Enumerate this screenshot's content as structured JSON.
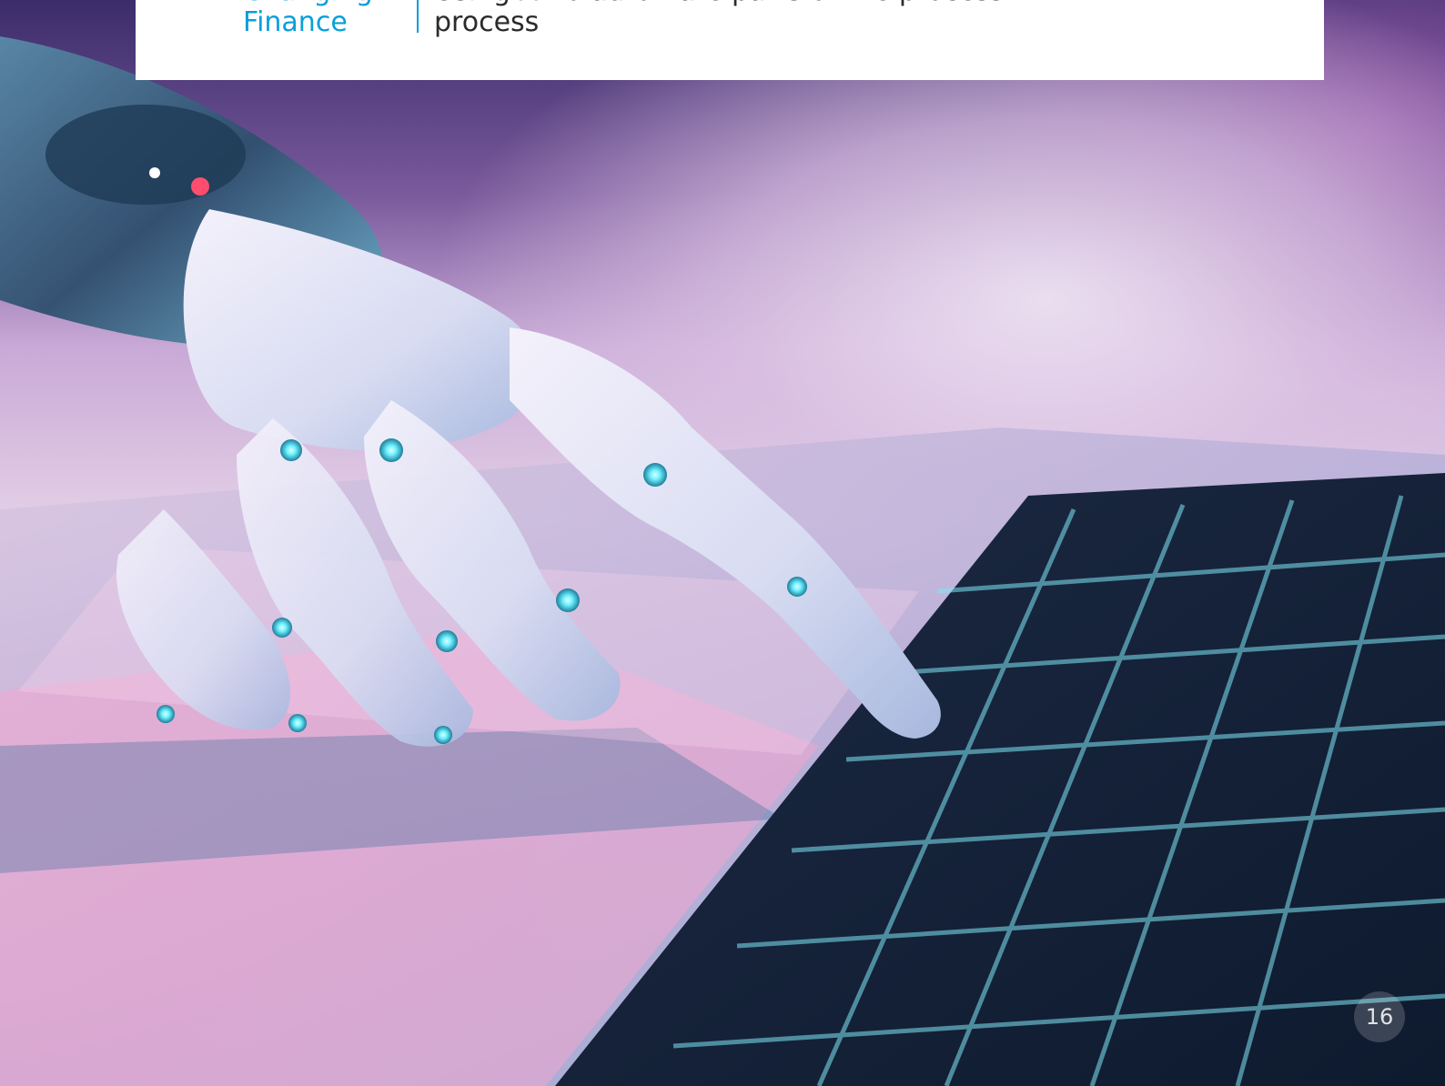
{
  "header": {
    "section_line1": "Changing",
    "section_line2": "Finance",
    "heading_line1": "Using AI to automate parts of the process",
    "heading_line2": "process"
  },
  "page": {
    "number": "16"
  },
  "photo": {
    "subject": "robot-hand-pressing-laptop-key",
    "colors": {
      "accent": "#0a9fd8",
      "glow": "#6ff2ff",
      "pink": "#f08cc4",
      "purple": "#6a4a8f"
    }
  }
}
